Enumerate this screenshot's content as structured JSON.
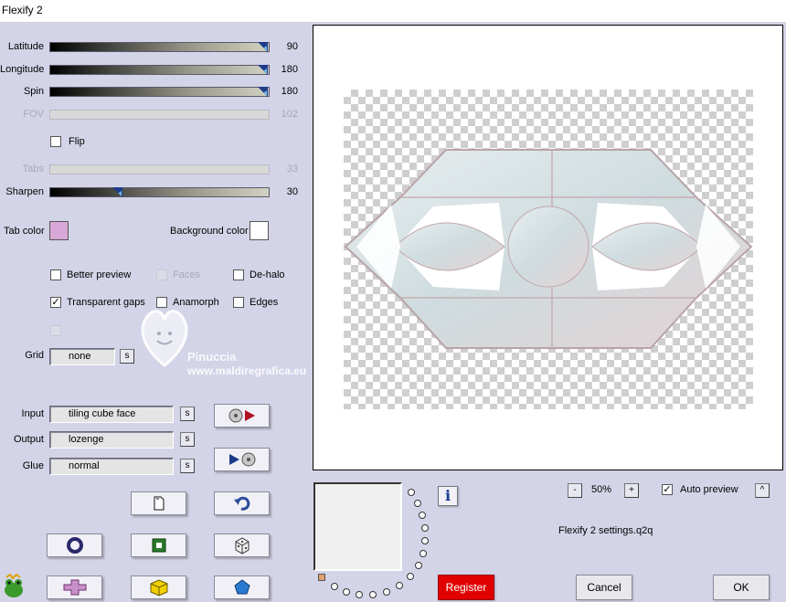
{
  "window": {
    "title": "Flexify 2"
  },
  "sliders": [
    {
      "label": "Latitude",
      "value": "90",
      "enabled": true,
      "level": 0.97
    },
    {
      "label": "Longitude",
      "value": "180",
      "enabled": true,
      "level": 0.97
    },
    {
      "label": "Spin",
      "value": "180",
      "enabled": true,
      "level": 0.97
    },
    {
      "label": "FOV",
      "value": "102",
      "enabled": false
    },
    {
      "label": "Tabs",
      "value": "33",
      "enabled": false
    },
    {
      "label": "Sharpen",
      "value": "30",
      "enabled": true,
      "level": 0.31
    }
  ],
  "flip": {
    "label": "Flip",
    "checked": false
  },
  "tab_color": {
    "label": "Tab color",
    "color": "#d8a8d8"
  },
  "background_color": {
    "label": "Background color",
    "color": "#ffffff"
  },
  "options": {
    "better_preview": {
      "label": "Better preview",
      "checked": false
    },
    "faces": {
      "label": "Faces",
      "checked": false,
      "enabled": false
    },
    "de_halo": {
      "label": "De-halo",
      "checked": false
    },
    "transparent_gaps": {
      "label": "Transparent gaps",
      "checked": true,
      "mark": "✓"
    },
    "anamorph": {
      "label": "Anamorph",
      "checked": false
    },
    "edges": {
      "label": "Edges",
      "checked": false
    }
  },
  "grid": {
    "label": "Grid",
    "value": "none",
    "s": "s"
  },
  "input": {
    "label": "Input",
    "value": "tiling cube face",
    "s": "s"
  },
  "output": {
    "label": "Output",
    "value": "lozenge",
    "s": "s"
  },
  "glue": {
    "label": "Glue",
    "value": "normal",
    "s": "s"
  },
  "watermark": {
    "name": "Pinuccia",
    "url": "www.maldiregrafica.eu"
  },
  "zoom": {
    "minus": "-",
    "value": "50%",
    "plus": "+"
  },
  "auto_preview": {
    "label": "Auto preview",
    "checked": true,
    "mark": "✓",
    "caret": "^"
  },
  "settings_file": "Flexify 2 settings.q2q",
  "info_label": "i",
  "buttons": {
    "register": "Register",
    "cancel": "Cancel",
    "ok": "OK"
  },
  "colors": {
    "register_bg": "#e00000",
    "tab_color": "#d8a8d8"
  },
  "icons": [
    "import-disc-icon",
    "export-disc-icon",
    "new-document-icon",
    "undo-icon",
    "ring-icon",
    "green-square-icon",
    "dice-icon",
    "plus-shape-icon",
    "yellow-cube-icon",
    "pentagon-icon",
    "frog-logo-icon",
    "heart-watermark-icon"
  ]
}
